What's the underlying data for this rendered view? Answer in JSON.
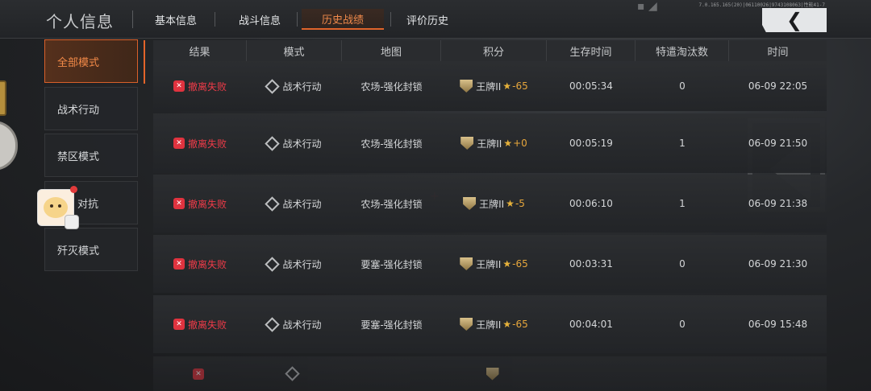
{
  "header": {
    "title": "个人信息",
    "tabs": [
      "基本信息",
      "战斗信息",
      "历史战绩",
      "评价历史"
    ],
    "active_tab": "历史战绩",
    "status_text": "7.0.165.165(20)|06110026|9743108063|性能41-7",
    "back_icon": "chevron-left-icon"
  },
  "sidebar": {
    "items": [
      "全部模式",
      "战术行动",
      "禁区模式",
      "对抗",
      "歼灭模式"
    ],
    "active": "全部模式"
  },
  "table": {
    "columns": [
      "结果",
      "模式",
      "地图",
      "积分",
      "生存时间",
      "特遣淘汰数",
      "时间"
    ],
    "rows": [
      {
        "result": "撤离失败",
        "mode": "战术行动",
        "map": "农场-强化封锁",
        "rank": "王牌II",
        "delta": "-65",
        "survival": "00:05:34",
        "kills": "0",
        "time": "06-09 22:05"
      },
      {
        "result": "撤离失败",
        "mode": "战术行动",
        "map": "农场-强化封锁",
        "rank": "王牌II",
        "delta": "+0",
        "survival": "00:05:19",
        "kills": "1",
        "time": "06-09 21:50"
      },
      {
        "result": "撤离失败",
        "mode": "战术行动",
        "map": "农场-强化封锁",
        "rank": "王牌II",
        "delta": "-5",
        "survival": "00:06:10",
        "kills": "1",
        "time": "06-09 21:38"
      },
      {
        "result": "撤离失败",
        "mode": "战术行动",
        "map": "要塞-强化封锁",
        "rank": "王牌II",
        "delta": "-65",
        "survival": "00:03:31",
        "kills": "0",
        "time": "06-09 21:30"
      },
      {
        "result": "撤离失败",
        "mode": "战术行动",
        "map": "要塞-强化封锁",
        "rank": "王牌II",
        "delta": "-65",
        "survival": "00:04:01",
        "kills": "0",
        "time": "06-09 15:48"
      }
    ]
  },
  "colors": {
    "accent": "#e3642a",
    "fail": "#ee3b48",
    "score": "#e6a63c"
  }
}
